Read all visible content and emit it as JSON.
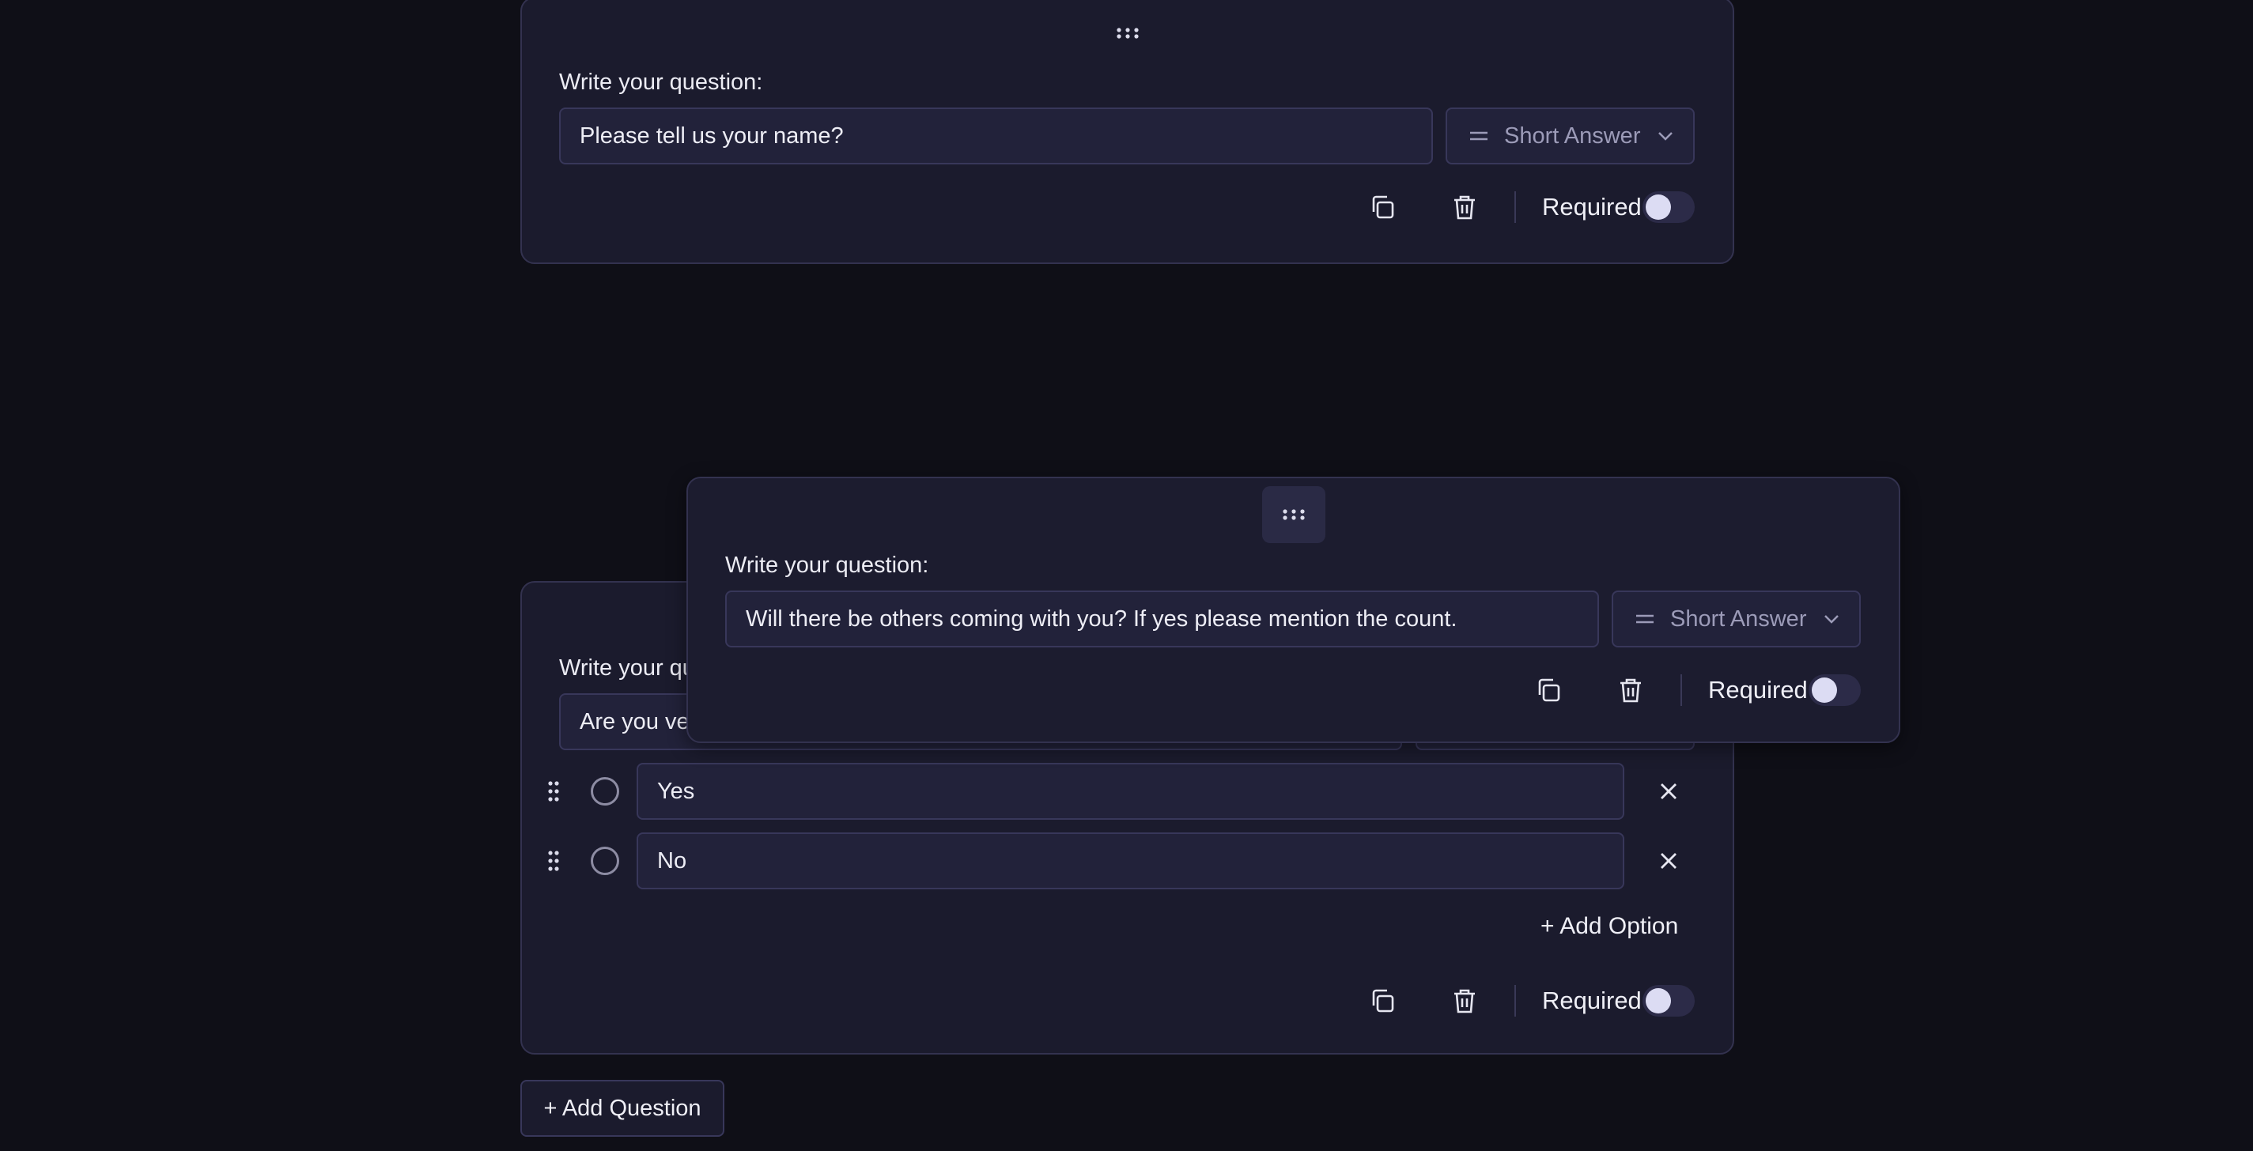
{
  "questions": [
    {
      "label": "Write your question:",
      "question_value": "Please tell us your name?",
      "type": "Short Answer",
      "required_label": "Required",
      "required": false
    },
    {
      "label": "Write your question:",
      "question_value": "Are you ve",
      "options": [
        {
          "value": "Yes"
        },
        {
          "value": "No"
        }
      ],
      "add_option_label": "+ Add Option",
      "required_label": "Required",
      "required": false
    }
  ],
  "dragging_question": {
    "label": "Write your question:",
    "question_value": "Will there be others coming with you? If yes please mention the count.",
    "type": "Short Answer",
    "required_label": "Required",
    "required": false
  },
  "add_question_label": "+ Add Question",
  "icons": {
    "drag": "grip-horizontal-icon",
    "copy": "copy-icon",
    "delete": "trash-icon",
    "type": "equals-icon",
    "chevron": "chevron-down-icon",
    "option_drag": "grip-vertical-icon",
    "remove": "close-icon"
  },
  "colors": {
    "background": "#0f0f17",
    "card": "#1b1b2d",
    "border": "#33324f",
    "input": "#22223a",
    "toggle_knob": "#dcdcf3"
  }
}
